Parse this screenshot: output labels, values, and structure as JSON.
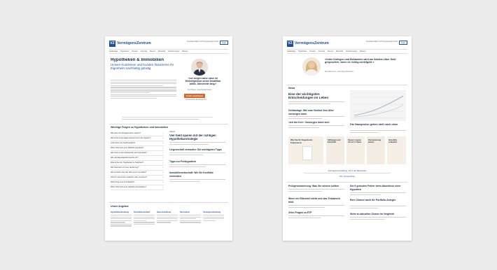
{
  "left_page": {
    "brand": "VermögensZentrum",
    "logo_text": "VZ",
    "top_links": "Kontakt  Filialen  VZ Finanzportal  Kunde",
    "login": "Login",
    "nav": [
      "Geldanlage",
      "Hypotheken",
      "Pension",
      "Vorsorge",
      "Steuern",
      "Erbschaft",
      "Versicherungen",
      "Weitere"
    ],
    "hero_title": "Hypotheken & Immobilien",
    "hero_subtitle": "Unsere Kundinnen und Kunden finanzieren ihr Eigenheim nachhaltig günstig",
    "quote": "«Sie sorgen dafür, dass Ihr Wohneigentum sicher bezahlbar bleibt, Jahrzehnte lang.»",
    "quote_author": "Kai Pfister, Hypothekarberater",
    "cta": "Termin vereinbaren",
    "cta_sub": "Kostenloses Erstgespräch",
    "faq_title": "Wichtige Fragen zu Hypotheken und Immobilien",
    "faq": [
      "Wie kann ich als Eigentümer sparen?",
      "Wie hoch ist der Eigenmietwert bei mehr Sparen?",
      "Lohnt sich eine Festhypothek?",
      "Wann lohnt sich eine SARON-Hypothek?",
      "Wie hoch ist der Aufwand für eine Hypothek?",
      "Wie viel Eigenkapital brauche ich?",
      "Was ist bei der Tragbarkeit zu beachten?",
      "Wie finanziere ich eine Sanierung?",
      "Wie ermittelt man den Wert einer Immobilie?",
      "Soll ich mein Haus verkaufen oder vererben?",
      "Was bringt eine Amortisation?",
      "Wann lohnt sich eine indirekte Amortisation?"
    ],
    "news_label": "Aktuell",
    "news": [
      {
        "title": "Viel Geld sparen mit der richtigen Hypothekarstrategie"
      },
      {
        "title": "Liegenschaft verkaufen: Die wichtigsten Tipps"
      },
      {
        "title": "Tipps zur Festhypothek"
      },
      {
        "title": "Immobilienerbschaft: Wie Sie Konflikte vermeiden"
      }
    ],
    "section2_title": "Unser Angebot",
    "offers": [
      "Hypothekenberatung",
      "Immobilienverkauf",
      "Hausverwaltung",
      "Renovation",
      "Vermögensberatung"
    ]
  },
  "right_page": {
    "brand": "VermögensZentrum",
    "logo_text": "VZ",
    "top_links": "Kontakt  Filialen  VZ Finanzportal  Kunde",
    "login": "Login",
    "nav": [
      "Geldanlage",
      "Hypotheken",
      "Pension",
      "Vorsorge",
      "Steuern",
      "Erbschaft",
      "Versicherungen",
      "Weitere"
    ],
    "quote": "«Unter Kollegen und Bekannten wird am liebsten über Geld gesprochen, wenn es richtig schiefgeht.»",
    "quote_author": "Eva Baumann, Vermögensberaterin",
    "news_label": "News",
    "main_story": "Eine der wichtigsten Entscheidungen im Leben",
    "stories": [
      "Geldanlage: Wie man flexibel fürs Alter vorsorgen kann",
      "Die Hauspreise gehen steil nach oben",
      "«Ich bin frei»: Vorsorgen lohnt sich"
    ],
    "cards": [
      "Wie Sie Ihr Eigenheim finanzieren",
      "Stiftungen und Erbschaft",
      "Steuern sparen mit der 3. Säule",
      "Pensionierung planen",
      "Immobilie verkaufen"
    ],
    "banner1": "Vermögensverwaltung: VZ in der Bestenliste",
    "banner2": "Ihre VZ-Hypothek",
    "lower_stories": [
      "Frühpensionierung: Was Sie wissen sollten",
      "Die 5 grössten Fehler beim Abschluss einer Hypothek",
      "Wenn ein Elternteil stirbt und das Testament fehlt",
      "Eine Chance auch für Portfolio-Anleger",
      "Zehn Fragen zu ETF",
      "Stets zu aktuellen Zinsen im Vergleich"
    ]
  },
  "colors": {
    "background": "#ececec",
    "brand_blue": "#1d4f9a",
    "accent_orange": "#d4682e",
    "card_beige": "#f6efe6"
  }
}
